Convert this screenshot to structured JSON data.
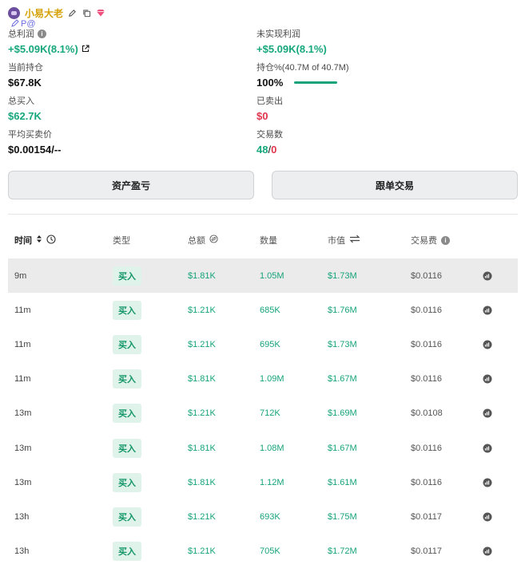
{
  "colors": {
    "green": "#16a37a",
    "red": "#e0344c",
    "name": "#d4a106",
    "badge_bg": "#dff3ea"
  },
  "header": {
    "name": "小易大老",
    "icons": [
      "avatar-icon",
      "edit-icon",
      "copy-icon",
      "diamond-icon"
    ],
    "sub_icons": [
      "pen-icon",
      "p-icon",
      "at-icon"
    ],
    "sub_text": "P@"
  },
  "stats": {
    "total_profit": {
      "label": "总利润",
      "value": "+$5.09K(8.1%)"
    },
    "unrealized": {
      "label": "未实现利润",
      "value": "+$5.09K(8.1%)"
    },
    "holding": {
      "label": "当前持仓",
      "value": "$67.8K"
    },
    "holding_pct": {
      "label": "持仓%(40.7M of 40.7M)",
      "value": "100%",
      "progress": 1.0
    },
    "total_buy": {
      "label": "总买入",
      "value": "$62.7K"
    },
    "sold": {
      "label": "已卖出",
      "value": "$0"
    },
    "avg_price": {
      "label": "平均买卖价",
      "value": "$0.00154/--"
    },
    "trades": {
      "label": "交易数",
      "buys": "48",
      "sep": "/",
      "sells": "0"
    }
  },
  "buttons": {
    "asset_pnl": "资产盈亏",
    "copy_trade": "跟单交易"
  },
  "table": {
    "headers": {
      "time": "时间",
      "type": "类型",
      "total": "总额",
      "qty": "数量",
      "mcap": "市值",
      "fee": "交易费"
    },
    "rows": [
      {
        "time": "9m",
        "type": "买入",
        "total": "$1.81K",
        "qty": "1.05M",
        "mcap": "$1.73M",
        "fee": "$0.0116"
      },
      {
        "time": "11m",
        "type": "买入",
        "total": "$1.21K",
        "qty": "685K",
        "mcap": "$1.76M",
        "fee": "$0.0116"
      },
      {
        "time": "11m",
        "type": "买入",
        "total": "$1.21K",
        "qty": "695K",
        "mcap": "$1.73M",
        "fee": "$0.0116"
      },
      {
        "time": "11m",
        "type": "买入",
        "total": "$1.81K",
        "qty": "1.09M",
        "mcap": "$1.67M",
        "fee": "$0.0116"
      },
      {
        "time": "13m",
        "type": "买入",
        "total": "$1.21K",
        "qty": "712K",
        "mcap": "$1.69M",
        "fee": "$0.0108"
      },
      {
        "time": "13m",
        "type": "买入",
        "total": "$1.81K",
        "qty": "1.08M",
        "mcap": "$1.67M",
        "fee": "$0.0116"
      },
      {
        "time": "13m",
        "type": "买入",
        "total": "$1.81K",
        "qty": "1.12M",
        "mcap": "$1.61M",
        "fee": "$0.0116"
      },
      {
        "time": "13h",
        "type": "买入",
        "total": "$1.21K",
        "qty": "693K",
        "mcap": "$1.75M",
        "fee": "$0.0117"
      },
      {
        "time": "13h",
        "type": "买入",
        "total": "$1.21K",
        "qty": "705K",
        "mcap": "$1.72M",
        "fee": "$0.0117"
      }
    ]
  }
}
